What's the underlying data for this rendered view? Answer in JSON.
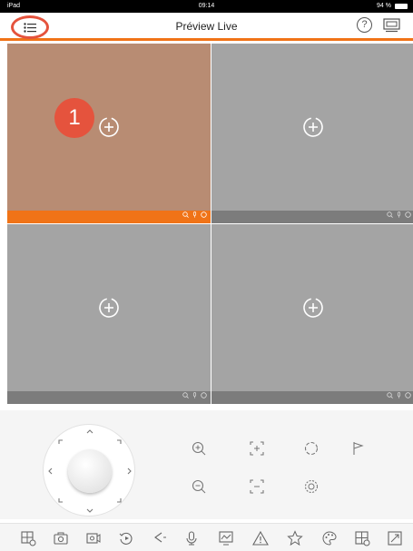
{
  "status": {
    "device": "iPad",
    "time": "09:14",
    "battery": "94 %"
  },
  "navbar": {
    "title": "Préview Live",
    "help_label": "?"
  },
  "tutorial_badge": "1",
  "theme": {
    "accent": "#f07317",
    "highlight": "#e5533d",
    "tile_bg": "#a4a4a4",
    "active_tile_bg": "#b88c73"
  },
  "tiles": [
    {
      "state": "selected",
      "icon": "add-camera-icon"
    },
    {
      "state": "empty",
      "icon": "add-camera-icon"
    },
    {
      "state": "empty",
      "icon": "add-camera-icon"
    },
    {
      "state": "empty",
      "icon": "add-camera-icon"
    }
  ],
  "tile_bar_icons": [
    "zoom-icon",
    "microphone-icon",
    "record-icon"
  ],
  "ptz": {
    "joystick": "ptz-joystick",
    "buttons": [
      "zoom-in-icon",
      "focus-near-icon",
      "iris-open-icon",
      "preset-flag-icon",
      "zoom-out-icon",
      "focus-far-icon",
      "iris-close-icon"
    ]
  },
  "toolbar": [
    "playback-icon",
    "snapshot-icon",
    "record-video-icon",
    "instant-playback-icon",
    "audio-icon",
    "talk-icon",
    "image-settings-icon",
    "alarm-icon",
    "favorite-icon",
    "color-icon",
    "window-division-icon",
    "fullscreen-icon"
  ]
}
